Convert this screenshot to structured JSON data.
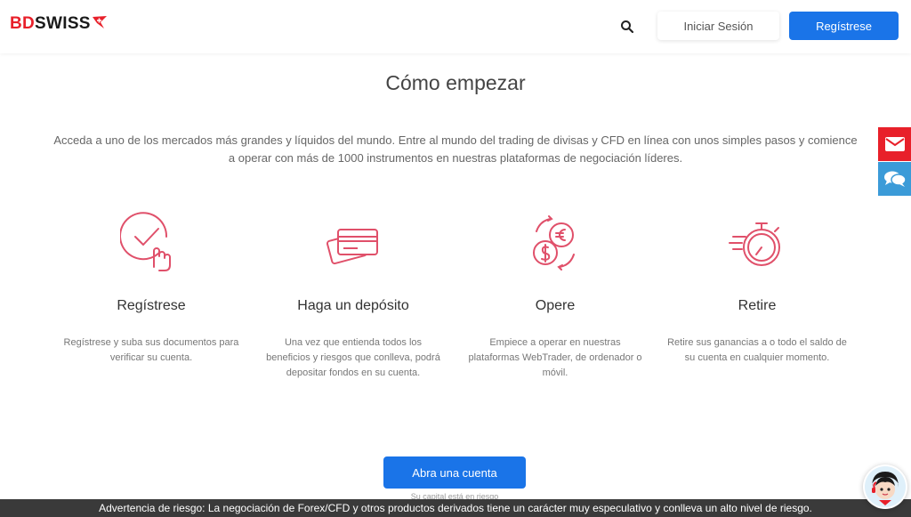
{
  "header": {
    "logo_bd": "BD",
    "logo_swiss": "SWISS",
    "search_icon": "search-icon",
    "login_label": "Iniciar Sesión",
    "register_label": "Regístrese"
  },
  "main": {
    "title": "Cómo empezar",
    "intro": "Acceda a uno de los mercados más grandes y líquidos del mundo. Entre al mundo del trading de divisas y CFD en línea con unos simples pasos y comience a operar con más de 1000 instrumentos en nuestras plataformas de negociación líderes.",
    "steps": [
      {
        "icon": "touch-check-icon",
        "title": "Regístrese",
        "text": "Regístrese y suba sus documentos para verificar su cuenta."
      },
      {
        "icon": "cards-icon",
        "title": "Haga un depósito",
        "text": "Una vez que entienda todos los beneficios y riesgos que conlleva, podrá depositar fondos en su cuenta."
      },
      {
        "icon": "currency-exchange-icon",
        "title": "Opere",
        "text": "Empiece a operar en nuestras plataformas WebTrader, de ordenador o móvil."
      },
      {
        "icon": "stopwatch-icon",
        "title": "Retire",
        "text": "Retire sus ganancias a o todo el saldo de su cuenta en cualquier momento."
      }
    ],
    "cta_label": "Abra una cuenta",
    "cta_note": "Su capital está en riesgo"
  },
  "side": {
    "email_icon": "envelope-icon",
    "chat_icon": "chat-icon"
  },
  "footer": {
    "risk_warning": "Advertencia de riesgo: La negociación de Forex/CFD y otros productos derivados tiene un carácter muy especulativo y conlleva un alto nivel de riesgo."
  },
  "colors": {
    "brand_red": "#e8202a",
    "primary_blue": "#1a74e8",
    "chat_blue": "#3b9bd8",
    "icon_pink": "#e0506a",
    "risk_bar": "#3a3a3a"
  }
}
